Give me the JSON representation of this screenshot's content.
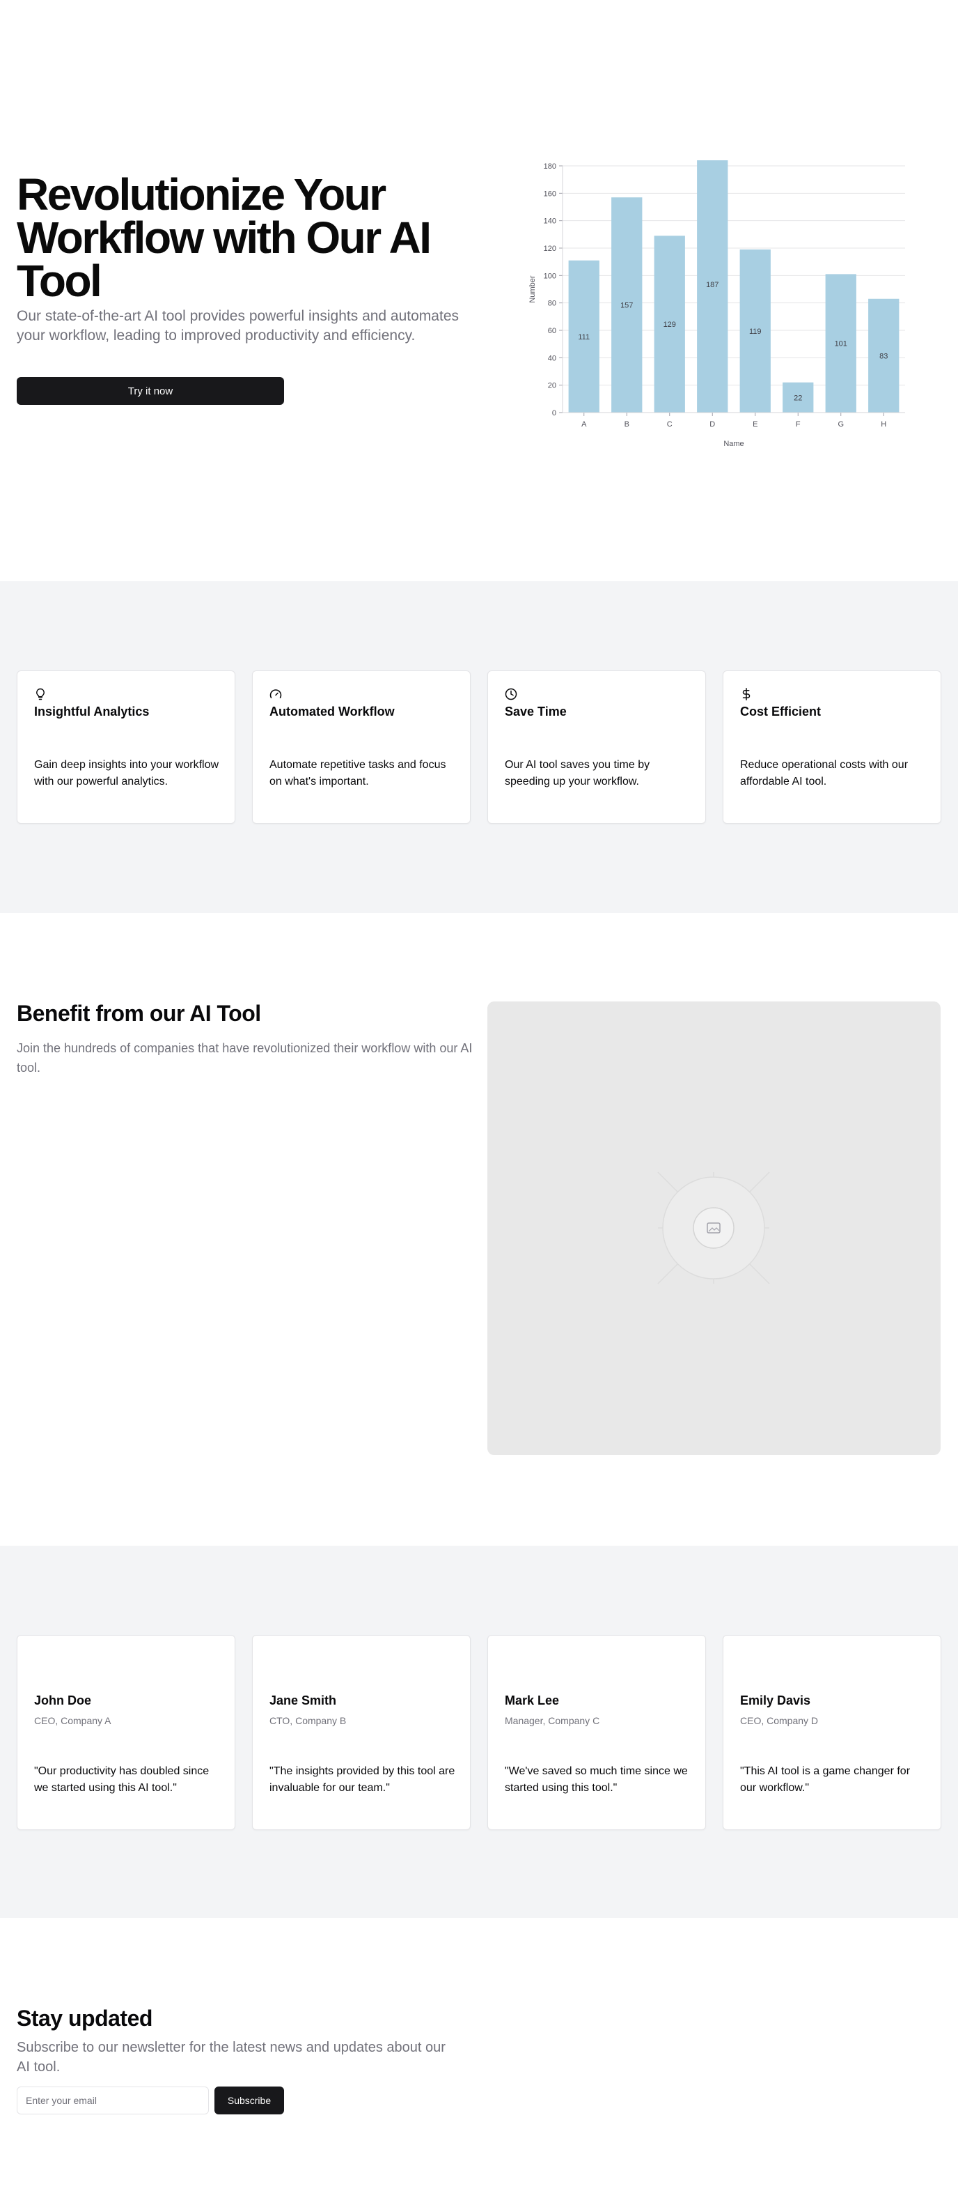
{
  "hero": {
    "title": "Revolutionize Your Workflow with Our AI Tool",
    "subtitle": "Our state-of-the-art AI tool provides powerful insights and automates your workflow, leading to improved productivity and efficiency.",
    "cta_label": "Try it now"
  },
  "chart_data": {
    "type": "bar",
    "categories": [
      "A",
      "B",
      "C",
      "D",
      "E",
      "F",
      "G",
      "H"
    ],
    "values": [
      111,
      157,
      129,
      187,
      119,
      22,
      101,
      83
    ],
    "xlabel": "Name",
    "ylabel": "Number",
    "ylim": [
      0,
      180
    ],
    "yticks": [
      0,
      20,
      40,
      60,
      80,
      100,
      120,
      140,
      160,
      180
    ],
    "grid": true,
    "bar_color": "#a8cfe2",
    "data_labels": true
  },
  "features": [
    {
      "icon": "lightbulb-icon",
      "title": "Insightful Analytics",
      "desc": "Gain deep insights into your workflow with our powerful analytics."
    },
    {
      "icon": "gauge-icon",
      "title": "Automated Workflow",
      "desc": "Automate repetitive tasks and focus on what's important."
    },
    {
      "icon": "clock-icon",
      "title": "Save Time",
      "desc": "Our AI tool saves you time by speeding up your workflow."
    },
    {
      "icon": "dollar-icon",
      "title": "Cost Efficient",
      "desc": "Reduce operational costs with our affordable AI tool."
    }
  ],
  "benefit": {
    "title": "Benefit from our AI Tool",
    "subtitle": "Join the hundreds of companies that have revolutionized their workflow with our AI tool.",
    "image_icon": "image-placeholder-icon"
  },
  "testimonials": [
    {
      "name": "John Doe",
      "role": "CEO, Company A",
      "quote": "\"Our productivity has doubled since we started using this AI tool.\""
    },
    {
      "name": "Jane Smith",
      "role": "CTO, Company B",
      "quote": "\"The insights provided by this tool are invaluable for our team.\""
    },
    {
      "name": "Mark Lee",
      "role": "Manager, Company C",
      "quote": "\"We've saved so much time since we started using this tool.\""
    },
    {
      "name": "Emily Davis",
      "role": "CEO, Company D",
      "quote": "\"This AI tool is a game changer for our workflow.\""
    }
  ],
  "newsletter": {
    "title": "Stay updated",
    "subtitle": "Subscribe to our newsletter for the latest news and updates about our AI tool.",
    "email_placeholder": "Enter your email",
    "subscribe_label": "Subscribe"
  },
  "colors": {
    "primary": "#18181b",
    "muted_text": "#71717a",
    "section_bg": "#f3f4f6",
    "bar": "#a8cfe2"
  }
}
